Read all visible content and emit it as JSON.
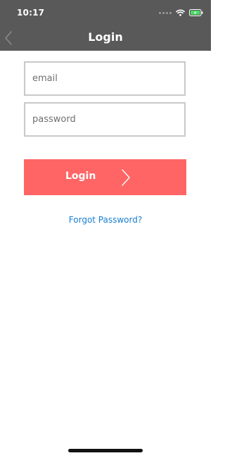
{
  "status_bar": {
    "time": "10:17",
    "icons": [
      "signal-dots-icon",
      "wifi-icon",
      "battery-charging-icon"
    ]
  },
  "nav": {
    "title": "Login",
    "back_icon": "chevron-left-icon"
  },
  "form": {
    "email_placeholder": "email",
    "email_value": "",
    "password_placeholder": "password",
    "password_value": "",
    "login_label": "Login",
    "login_icon": "chevron-right-icon",
    "forgot_link": "Forgot Password?"
  },
  "colors": {
    "header_bg": "#595959",
    "login_button": "#ff6565",
    "link": "#1a7fd0",
    "field_border": "#c9c9c9",
    "battery": "#4cd964"
  }
}
